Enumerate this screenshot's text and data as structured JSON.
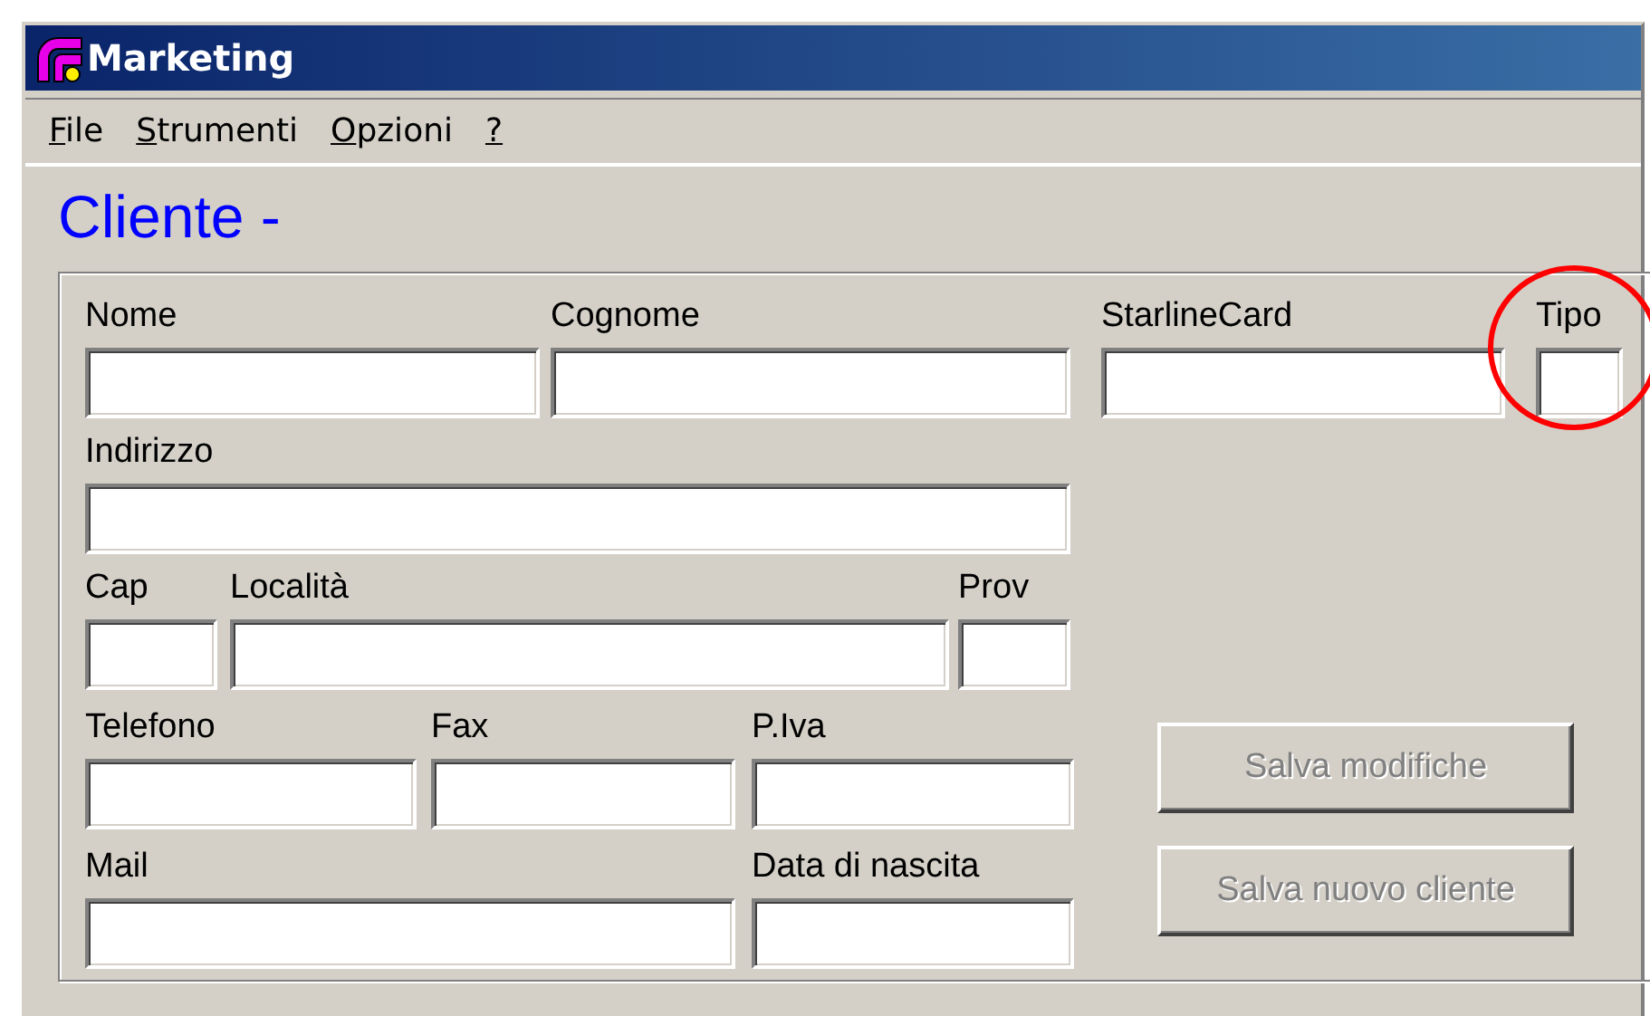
{
  "window": {
    "title": "Marketing"
  },
  "menu": [
    {
      "label": "File"
    },
    {
      "label": "Strumenti"
    },
    {
      "label": "Opzioni"
    },
    {
      "label": "?"
    }
  ],
  "heading": "Cliente -",
  "form": {
    "rows": [
      [
        {
          "label": "Nome"
        },
        {
          "label": "Cognome"
        },
        {
          "label": "StarlineCard"
        },
        {
          "label": "Tipo",
          "highlighted": true
        }
      ],
      [
        {
          "label": "Indirizzo"
        }
      ],
      [
        {
          "label": "Cap"
        },
        {
          "label": "Località"
        },
        {
          "label": "Prov"
        }
      ],
      [
        {
          "label": "Telefono"
        },
        {
          "label": "Fax"
        },
        {
          "label": "P.Iva"
        }
      ],
      [
        {
          "label": "Mail"
        },
        {
          "label": "Data di nascita"
        }
      ]
    ]
  },
  "buttons": [
    {
      "label": "Salva modifiche",
      "disabled": true
    },
    {
      "label": "Salva nuovo cliente",
      "disabled": true
    }
  ]
}
